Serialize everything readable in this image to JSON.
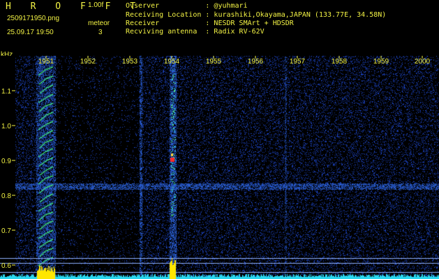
{
  "header": {
    "title": "H R O F F T",
    "version": "1.00f",
    "filename": "2509171950.png",
    "datetime": "25.09.17 19:50",
    "meteor_label": "meteor",
    "meteor_count": "3"
  },
  "info": [
    {
      "label": "Ovserver",
      "value": "@yuhmari"
    },
    {
      "label": "Receiving Location",
      "value": "kurashiki,Okayama,JAPAN (133.77E, 34.58N)"
    },
    {
      "label": "Receiver",
      "value": "NESDR SMArt + HDSDR"
    },
    {
      "label": "Recviving antenna",
      "value": "Radix RV-62V"
    }
  ],
  "axes": {
    "y_unit": "kHz",
    "x_tick_labels": [
      "1951",
      "1952",
      "1953",
      "1954",
      "1955",
      "1956",
      "1957",
      "1958",
      "1959",
      "2000"
    ],
    "y_tick_labels": [
      "1.1",
      "1.0",
      "0.9",
      "0.8",
      "0.7",
      "0.6"
    ]
  },
  "colors": {
    "text": "#f2f244",
    "background": "#000000",
    "noise": "#1a3ca8",
    "baseline": "#2ad8f0",
    "peak": "#ffe600",
    "hot": "#ff2020"
  }
}
